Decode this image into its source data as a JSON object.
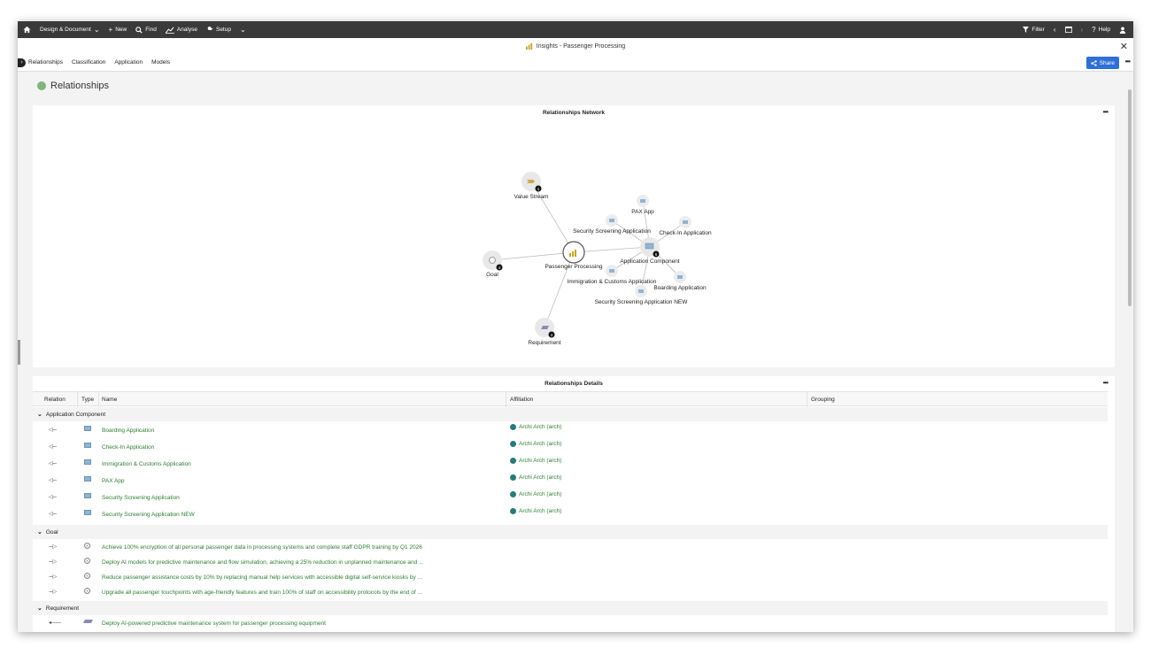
{
  "topbar": {
    "menu": [
      {
        "label": "Design & Document",
        "icon": "chevron-down-icon"
      },
      {
        "label": "New",
        "icon": "plus-icon"
      },
      {
        "label": "Find",
        "icon": "search-icon"
      },
      {
        "label": "Analyse",
        "icon": "chart-icon"
      },
      {
        "label": "Setup",
        "icon": "wrench-icon"
      }
    ],
    "filter_label": "Filter",
    "help_label": "Help"
  },
  "window": {
    "title": "Insights - Passenger Processing",
    "tabs": [
      "Relationships",
      "Classification",
      "Application",
      "Models"
    ],
    "share_label": "Share"
  },
  "section": {
    "title": "Relationships",
    "accent": "#7fb57f"
  },
  "network": {
    "title": "Relationships Network",
    "center": {
      "label": "Passenger Processing"
    },
    "nodes": [
      {
        "id": "vs",
        "label": "Value Stream",
        "count": "1"
      },
      {
        "id": "goal",
        "label": "Goal",
        "count": "4"
      },
      {
        "id": "req",
        "label": "Requirement",
        "count": "4"
      },
      {
        "id": "ac",
        "label": "Application Component",
        "count": "6"
      }
    ],
    "leaves": [
      {
        "label": "PAX App"
      },
      {
        "label": "Security Screening Application"
      },
      {
        "label": "Check-In Application"
      },
      {
        "label": "Immigration & Customs Application"
      },
      {
        "label": "Boarding Application"
      },
      {
        "label": "Security Screening Application NEW"
      }
    ]
  },
  "details": {
    "title": "Relationships Details",
    "columns": [
      "Relation",
      "Type",
      "Name",
      "Affiliation",
      "Grouping"
    ],
    "groups": [
      {
        "name": "Application Component",
        "rows": [
          {
            "relation": "◁---",
            "name": "Boarding Application",
            "affiliation": "Archi Arch (arch)"
          },
          {
            "relation": "◁---",
            "name": "Check-In Application",
            "affiliation": "Archi Arch (arch)"
          },
          {
            "relation": "◁---",
            "name": "Immigration & Customs Application",
            "affiliation": "Archi Arch (arch)"
          },
          {
            "relation": "◁---",
            "name": "PAX App",
            "affiliation": "Archi Arch (arch)"
          },
          {
            "relation": "◁---",
            "name": "Security Screening Application",
            "affiliation": "Archi Arch (arch)"
          },
          {
            "relation": "◁---",
            "name": "Security Screening Application NEW",
            "affiliation": "Archi Arch (arch)"
          }
        ]
      },
      {
        "name": "Goal",
        "rows": [
          {
            "relation": "---▷",
            "name": "Achieve 100% encryption of all personal passenger data in processing systems and complete staff GDPR training by Q1 2026",
            "affiliation": ""
          },
          {
            "relation": "---▷",
            "name": "Deploy AI models for predictive maintenance and flow simulation, achieving a 25% reduction in unplanned maintenance and ...",
            "affiliation": ""
          },
          {
            "relation": "---▷",
            "name": "Reduce passenger assistance costs by 10% by replacing manual help services with accessible digital self-service kiosks by ...",
            "affiliation": ""
          },
          {
            "relation": "---▷",
            "name": "Upgrade all passenger touchpoints with age-friendly features and train 100% of staff on accessibility protocols by the end of ...",
            "affiliation": ""
          }
        ]
      },
      {
        "name": "Requirement",
        "rows": [
          {
            "relation": "◂——",
            "name": "Deploy AI-powered predictive maintenance system for passenger processing equipment",
            "affiliation": ""
          }
        ]
      }
    ]
  }
}
